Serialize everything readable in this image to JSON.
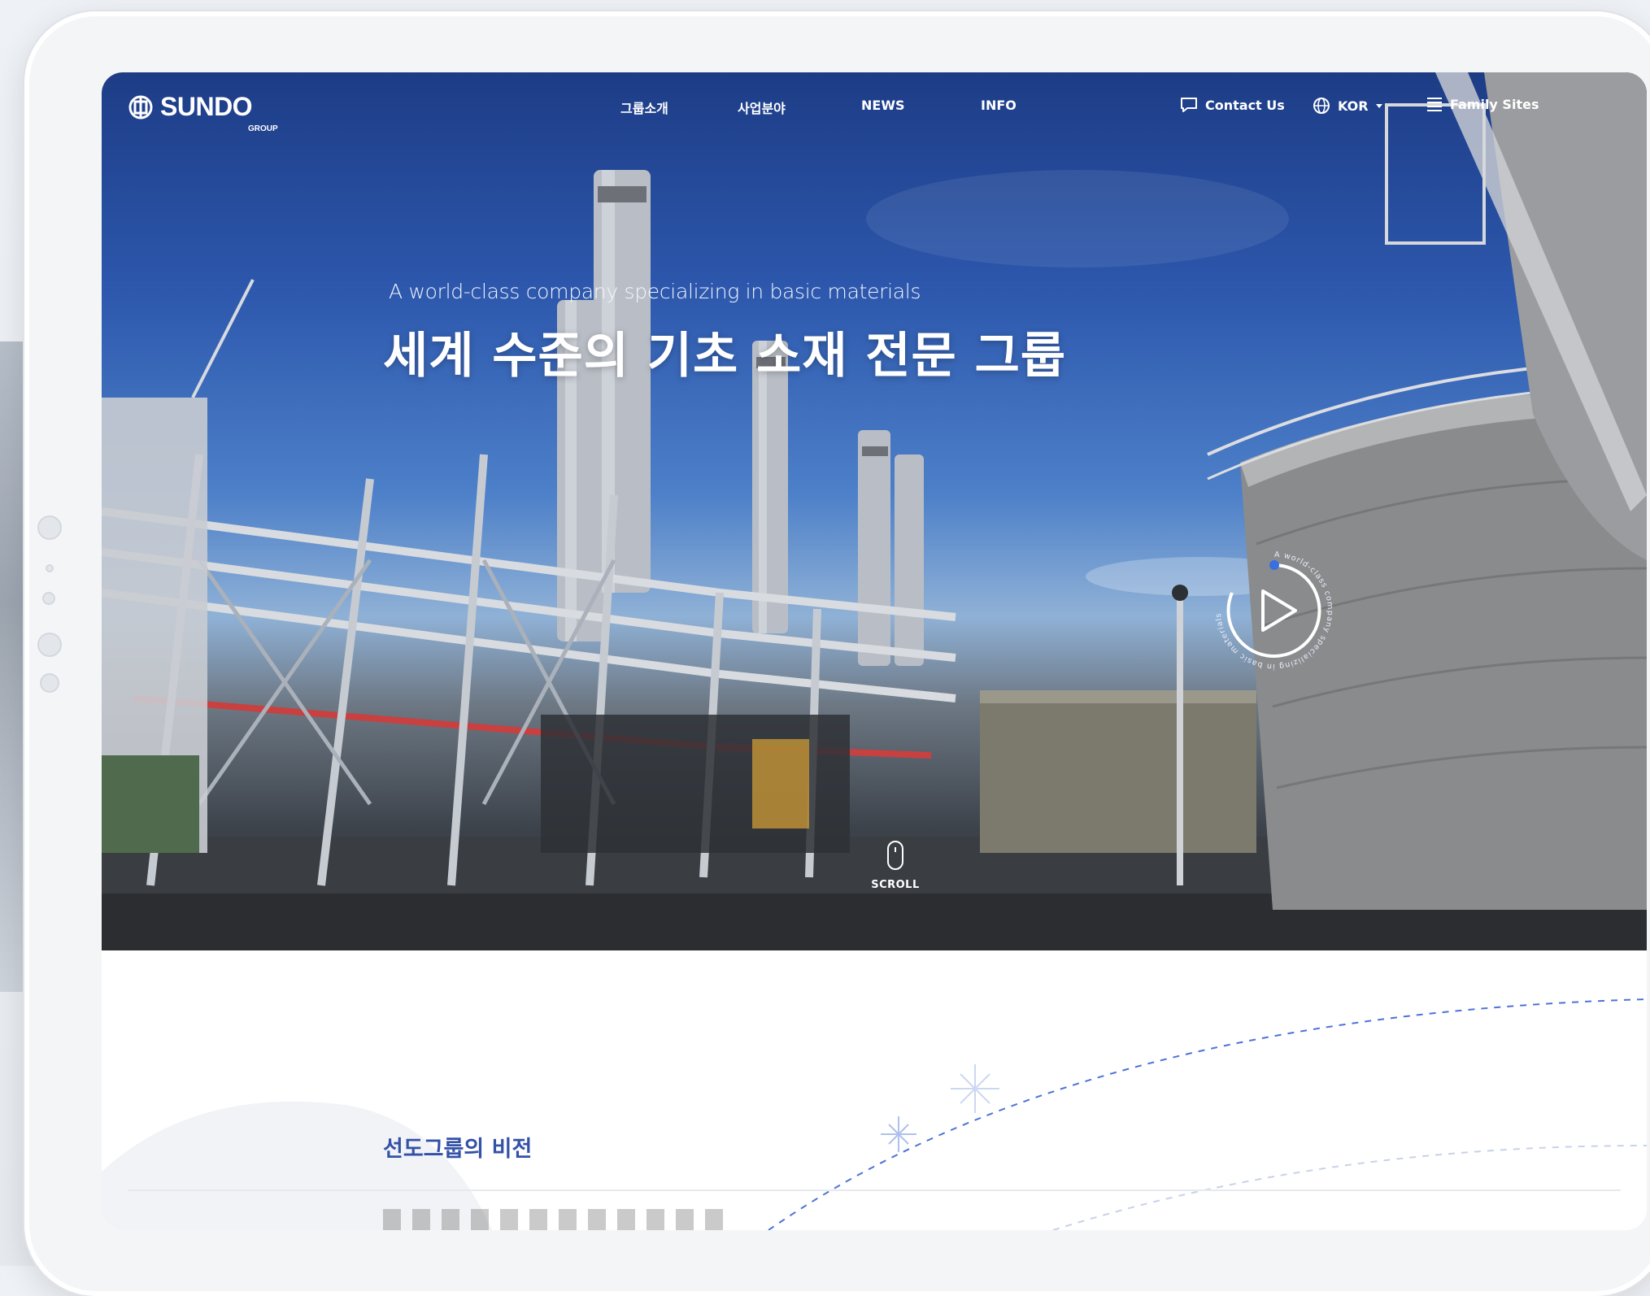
{
  "brand": {
    "logo_text": "SUNDO",
    "logo_sub": "GROUP",
    "logo_icon": "sundo-logo-icon"
  },
  "nav": {
    "menu": [
      "그룹소개",
      "사업분야",
      "NEWS",
      "INFO"
    ],
    "contact_label": "Contact Us",
    "language_label": "KOR",
    "family_label": "Family Sites"
  },
  "hero": {
    "subtitle": "A world-class company specializing in basic materials",
    "title": "세계 수준의 기초 소재 전문 그룹",
    "play_ring_text": "A world-class company specializing in basic materials",
    "scroll_label": "SCROLL"
  },
  "section": {
    "vision_label": "선도그룹의 비전"
  },
  "colors": {
    "accent": "#3451a8",
    "ring_dot": "#3a6fe0",
    "sky_top": "#1d3c86"
  }
}
